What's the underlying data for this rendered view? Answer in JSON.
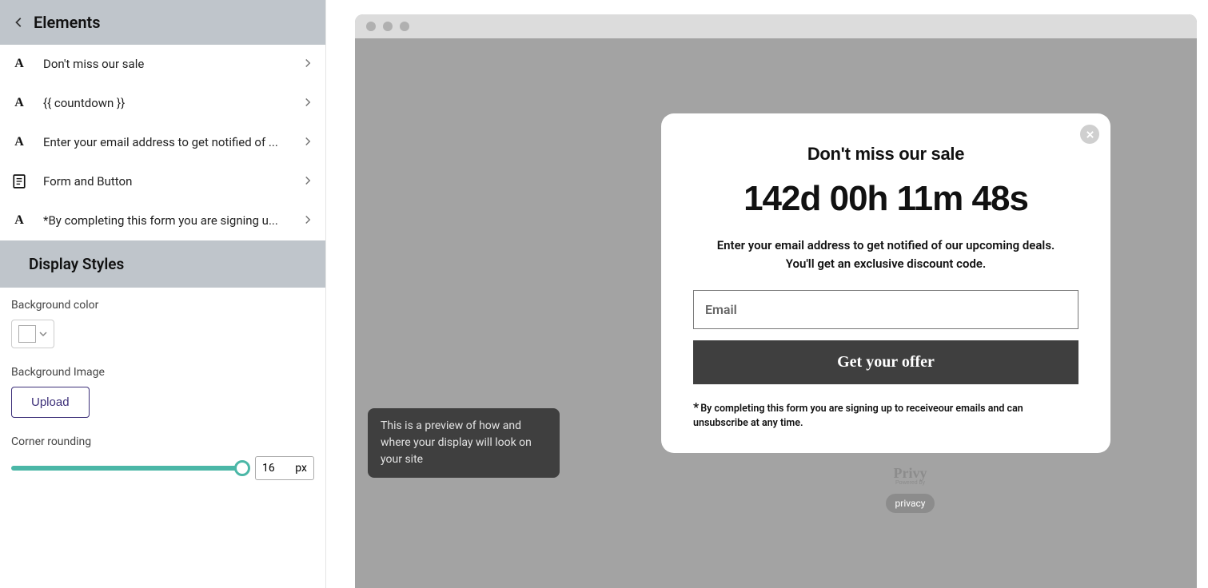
{
  "sidebar": {
    "title": "Elements",
    "items": [
      {
        "icon": "A",
        "label": "Don't miss our sale"
      },
      {
        "icon": "A",
        "label": "{{ countdown }}"
      },
      {
        "icon": "A",
        "label": "Enter your email address to get notified of ..."
      },
      {
        "icon": "form",
        "label": "Form and Button"
      },
      {
        "icon": "A",
        "label": "*By completing this form you are signing u..."
      }
    ]
  },
  "styles": {
    "title": "Display Styles",
    "bg_color_label": "Background color",
    "bg_color_value": "#ffffff",
    "bg_image_label": "Background Image",
    "upload_label": "Upload",
    "corner_label": "Corner rounding",
    "corner_value": "16",
    "corner_unit": "px"
  },
  "preview": {
    "tooltip": "This is a preview of how and where your display will look on your site",
    "popup": {
      "heading": "Don't miss our sale",
      "countdown": "142d 00h 11m 48s",
      "subtext": "Enter your email address to get notified of our upcoming deals. You'll get an exclusive discount code.",
      "input_placeholder": "Email",
      "cta_label": "Get your offer",
      "fine_print": "By completing this form you are signing up to receiveour emails and can unsubscribe at any time."
    },
    "branding": "Privy",
    "branding_sub": "Powered by",
    "privacy_label": "privacy"
  }
}
